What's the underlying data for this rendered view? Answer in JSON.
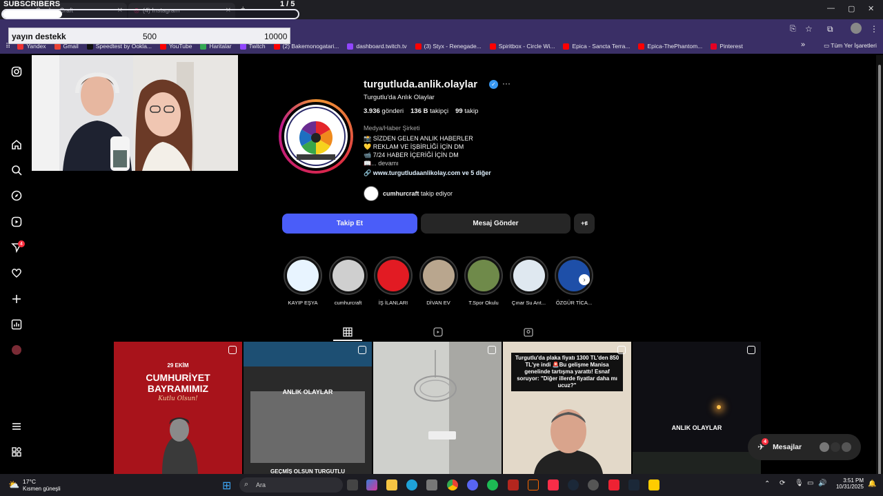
{
  "browser": {
    "tabs": [
      {
        "label": "Cumhur Craft",
        "active": false
      },
      {
        "label": "(4) Instagram",
        "active": true
      }
    ],
    "new_tab": "+",
    "window_controls": [
      "—",
      "▢",
      "✕"
    ],
    "bookmarks": [
      {
        "label": "Yandex",
        "color": "#e33"
      },
      {
        "label": "Gmail",
        "color": "#ea4335"
      },
      {
        "label": "Speedtest by Ookla...",
        "color": "#111"
      },
      {
        "label": "YouTube",
        "color": "#f00"
      },
      {
        "label": "Haritalar",
        "color": "#34a853"
      },
      {
        "label": "Twitch",
        "color": "#9146ff"
      },
      {
        "label": "(2) Bakemonogatari...",
        "color": "#f00"
      },
      {
        "label": "dashboard.twitch.tv",
        "color": "#9146ff"
      },
      {
        "label": "(3) Styx - Renegade...",
        "color": "#f00"
      },
      {
        "label": "Spiritbox - Circle Wi...",
        "color": "#f00"
      },
      {
        "label": "Epica - Sancta Terra...",
        "color": "#f00"
      },
      {
        "label": "Epica-ThePhantom...",
        "color": "#f00"
      },
      {
        "label": "Pinterest",
        "color": "#e60023"
      }
    ],
    "bookmarks_overflow": "»",
    "all_bookmarks": "Tüm Yer İşaretleri"
  },
  "overlay": {
    "subs_title": "SUBSCRIBERS",
    "subs_count": "1 / 5",
    "subs_progress": 0.2,
    "support_label": "yayın destekk",
    "support_current": "500",
    "support_goal": "10000"
  },
  "profile": {
    "username": "turgutluda.anlik.olaylar",
    "verified_mark": "✓",
    "more": "···",
    "full_name": "Turgutlu'da Anlık Olaylar",
    "posts_count": "3.936",
    "posts_label": "gönderi",
    "followers_count": "136 B",
    "followers_label": "takipçi",
    "following_count": "99",
    "following_label": "takip",
    "category": "Medya/Haber Şirketi",
    "bio_lines": [
      "📸 SİZDEN GELEN ANLIK HABERLER",
      "💛 REKLAM VE İŞBİRLİĞİ İÇİN DM",
      "📹 7/24 HABER İÇERİĞİ İÇİN DM",
      "📖... devamı"
    ],
    "link": "www.turgutludaanlikolay.com ve 5 diğer",
    "followed_by_name": "cumhurcraft",
    "followed_by_suffix": "takip ediyor",
    "follow_button": "Takip Et",
    "message_button": "Mesaj Gönder",
    "suggest_button": "+ዩ"
  },
  "highlights": [
    {
      "label": "KAYIP EŞYA",
      "color": "#e8f4ff"
    },
    {
      "label": "cumhurcraft",
      "color": "#cfcfcf"
    },
    {
      "label": "İŞ İLANLARI",
      "color": "#e21b23"
    },
    {
      "label": "DİVAN EV",
      "color": "#b9a68e"
    },
    {
      "label": "T.Spor Okulu",
      "color": "#6f8a4a"
    },
    {
      "label": "Çınar Su Arıt...",
      "color": "#dfe8f0"
    },
    {
      "label": "ÖZGÜR TİCA...",
      "color": "#1e4fa8"
    }
  ],
  "posts": [
    {
      "line1": "29 EKİM",
      "line2": "CUMHURİYET",
      "line3": "BAYRAMIMIZ",
      "line4": "Kutlu Olsun!",
      "bg": "#a8131b"
    },
    {
      "watermark": "ANLIK OLAYLAR",
      "caption": "GEÇMİŞ OLSUN TURGUTLU",
      "bg": "#2a2a2a"
    },
    {
      "bg": "#cfd0cc"
    },
    {
      "headline": "Turgutlu'da plaka fiyatı 1300 TL'den 850 TL'ye indi 🚨Bu gelişme Manisa genelinde tartışma yarattı! Esnaf soruyor: \"Diğer illerde fiyatlar daha mı ucuz?\"",
      "bg": "#e3d9c9"
    },
    {
      "watermark": "ANLIK OLAYLAR",
      "bg": "#0f0f14"
    }
  ],
  "messages": {
    "label": "Mesajlar",
    "badge": "4"
  },
  "nav_badge": "4",
  "taskbar": {
    "temp": "17°C",
    "weather": "Kısmen güneşli",
    "search": "Ara",
    "time": "3:51 PM",
    "date": "10/31/2025"
  }
}
